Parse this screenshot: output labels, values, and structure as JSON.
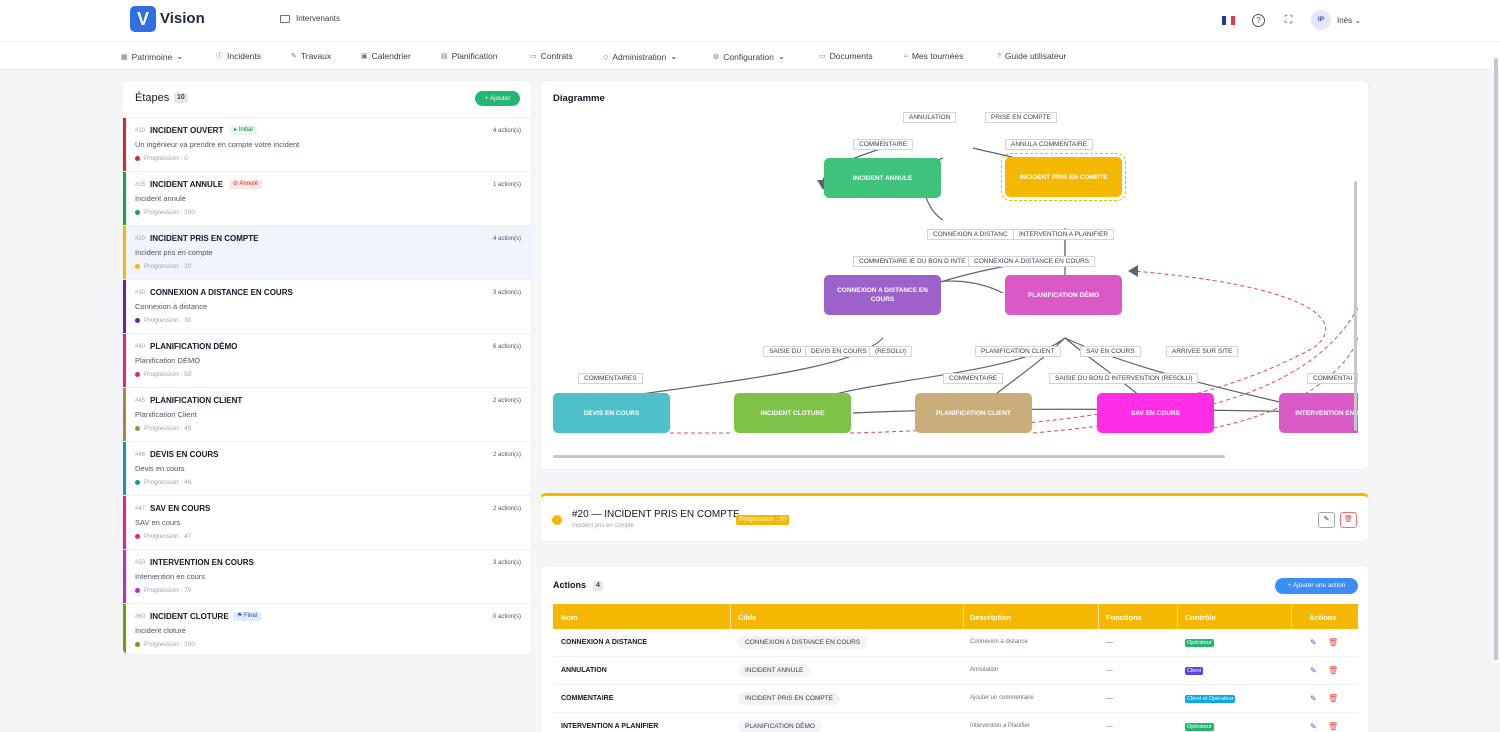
{
  "app": {
    "name": "Vision",
    "logo_letter": "V",
    "header_link": "Intervenants",
    "user_initials": "IP",
    "user_name": "Inès"
  },
  "colors": {
    "accent": "#2f6fe0",
    "primary_orange": "#f5b800",
    "green": "#22b573",
    "blue": "#3b8ef3"
  },
  "nav": [
    {
      "label": "Patrimoine",
      "icon": "building-icon",
      "caret": "⌄"
    },
    {
      "label": "Incidents",
      "icon": "alert-icon"
    },
    {
      "label": "Travaux",
      "icon": "tool-icon"
    },
    {
      "label": "Calendrier",
      "icon": "calendar-icon"
    },
    {
      "label": "Planification",
      "icon": "planning-icon"
    },
    {
      "label": "Contrats",
      "icon": "contract-icon"
    },
    {
      "label": "Administration",
      "icon": "shield-icon",
      "caret": "⌄"
    },
    {
      "label": "Configuration",
      "icon": "gear-icon",
      "caret": "⌄"
    },
    {
      "label": "Documents",
      "icon": "folder-icon"
    },
    {
      "label": "Mes tournées",
      "icon": "route-icon"
    },
    {
      "label": "Guide utilisateur",
      "icon": "help-icon"
    }
  ],
  "steps_panel": {
    "title": "Étapes",
    "count": "10",
    "add_label": "+ Ajouter"
  },
  "steps": [
    {
      "num": "#10",
      "name": "INCIDENT OUVERT",
      "tag": "▸ Initial",
      "actions": "4 action(s)",
      "desc": "Un ingénieur va prendre en compte votre incident",
      "progress": "Progression : 0",
      "color": "#dc2626"
    },
    {
      "num": "#15",
      "name": "INCIDENT ANNULE",
      "tag": "⊘ Annulé",
      "actions": "1 action(s)",
      "desc": "Incident annulé",
      "progress": "Progression : 100",
      "color": "#16a34a"
    },
    {
      "num": "#20",
      "name": "INCIDENT PRIS EN COMPTE",
      "tag": "",
      "actions": "4 action(s)",
      "desc": "Incident pris en compte",
      "progress": "Progression : 20",
      "color": "#f5b800"
    },
    {
      "num": "#30",
      "name": "CONNEXION A DISTANCE EN COURS",
      "tag": "",
      "actions": "3 action(s)",
      "desc": "Connexion à distance",
      "progress": "Progression : 30",
      "color": "#6b21a8"
    },
    {
      "num": "#40",
      "name": "PLANIFICATION DÉMO",
      "tag": "",
      "actions": "6 action(s)",
      "desc": "Planification DÉMO",
      "progress": "Progression : 50",
      "color": "#db2777"
    },
    {
      "num": "#45",
      "name": "PLANIFICATION CLIENT",
      "tag": "",
      "actions": "2 action(s)",
      "desc": "Planification Client",
      "progress": "Progression : 45",
      "color": "#a68a3c"
    },
    {
      "num": "#46",
      "name": "DEVIS EN COURS",
      "tag": "",
      "actions": "2 action(s)",
      "desc": "Devis en cours",
      "progress": "Progression : 46",
      "color": "#0e9aa7"
    },
    {
      "num": "#47",
      "name": "SAV EN COURS",
      "tag": "",
      "actions": "2 action(s)",
      "desc": "SAV en cours",
      "progress": "Progression : 47",
      "color": "#e91e8c"
    },
    {
      "num": "#50",
      "name": "INTERVENTION EN COURS",
      "tag": "",
      "actions": "3 action(s)",
      "desc": "Intervention en cours",
      "progress": "Progression : 70",
      "color": "#c026d3"
    },
    {
      "num": "#60",
      "name": "INCIDENT CLOTURE",
      "tag": "⚑ Final",
      "actions": "0 action(s)",
      "desc": "Incident cloturé",
      "progress": "Progression : 100",
      "color": "#65a30d"
    }
  ],
  "diagram": {
    "title": "Diagramme",
    "nodes": [
      "INCIDENT ANNULE",
      "INCIDENT PRIS EN COMPTE",
      "CONNEXION A DISTANCE EN COURS",
      "PLANIFICATION DÉMO",
      "DEVIS EN COURS",
      "INCIDENT CLOTURE",
      "PLANIFICATION CLIENT",
      "SAV EN COURS",
      "INTERVENTION EN COURS"
    ],
    "edges": [
      "ANNULATION",
      "PRISE EN COMPTE",
      "COMMENTAIRE",
      "ANNULA COMMENTAIRE",
      "CONNEXION A DISTANC",
      "INTERVENTION A PLANIFIER",
      "COMMENTAIRE IE DU BON D INTE",
      "CONNEXION A DISTANCE EN COURS",
      "SAISIE DU",
      "DEVIS EN COURS",
      "(RESOLU)",
      "PLANIFICATION CLIENT",
      "SAV EN COURS",
      "ARRIVEE SUR SITE",
      "COMMENTAIRES",
      "COMMENTAIRE",
      "SAISIE DU BON D INTERVENTION (RESOLU)",
      "COMMENTAI"
    ]
  },
  "selected": {
    "title": "#20 — INCIDENT PRIS EN COMPTE",
    "subtitle": "Incident pris en compte",
    "progress": "Progression : 20"
  },
  "actions_panel": {
    "title": "Actions",
    "count": "4",
    "add_label": "+ Ajouter une action",
    "columns": [
      "Nom",
      "Cible",
      "Description",
      "Fonctions",
      "Contrôle",
      "Actions"
    ],
    "rows": [
      {
        "name": "CONNEXION A DISTANCE",
        "target": "CONNEXION A DISTANCE EN COURS",
        "desc": "Connexion à distance",
        "fn": "—",
        "control": "Opérateur",
        "control_color": "#22b573"
      },
      {
        "name": "ANNULATION",
        "target": "INCIDENT ANNULE",
        "desc": "Annulation",
        "fn": "—",
        "control": "Client",
        "control_color": "#4f46e5"
      },
      {
        "name": "COMMENTAIRE",
        "target": "INCIDENT PRIS EN COMPTE",
        "desc": "Ajouter un commentaire",
        "fn": "—",
        "control": "Client et Opérateur",
        "control_color": "#0ea5e9"
      },
      {
        "name": "INTERVENTION A PLANIFIER",
        "target": "PLANIFICATION DÉMO",
        "desc": "Intervention a Planifier",
        "fn": "—",
        "control": "Opérateur",
        "control_color": "#22b573"
      }
    ]
  }
}
